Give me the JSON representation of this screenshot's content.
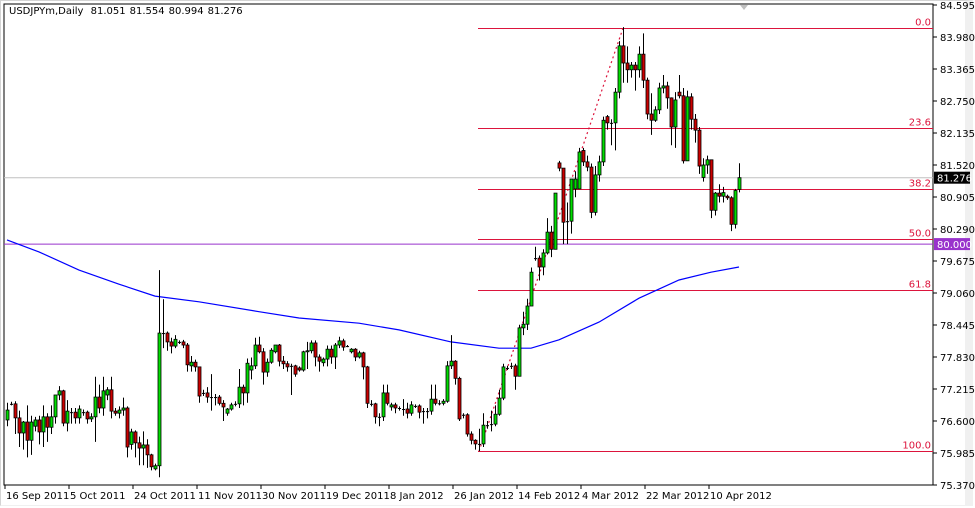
{
  "header": {
    "symbol": "USDJPYm,Daily",
    "open": "81.051",
    "high": "81.554",
    "low": "80.994",
    "close": "81.276"
  },
  "chart_data": {
    "type": "candlestick",
    "symbol": "USDJPYm",
    "timeframe": "Daily",
    "ylim": [
      75.37,
      84.595
    ],
    "y_ticks": [
      "84.595",
      "83.980",
      "83.365",
      "82.750",
      "82.135",
      "81.520",
      "80.905",
      "80.290",
      "79.675",
      "79.060",
      "78.445",
      "77.830",
      "77.215",
      "76.600",
      "75.985",
      "75.370"
    ],
    "x_ticks": [
      {
        "bar": 0,
        "label": "16 Sep 2011"
      },
      {
        "bar": 16,
        "label": "5 Oct 2011"
      },
      {
        "bar": 32,
        "label": "24 Oct 2011"
      },
      {
        "bar": 48,
        "label": "11 Nov 2011"
      },
      {
        "bar": 64,
        "label": "30 Nov 2011"
      },
      {
        "bar": 80,
        "label": "19 Dec 2011"
      },
      {
        "bar": 96,
        "label": "8 Jan 2012"
      },
      {
        "bar": 112,
        "label": "26 Jan 2012"
      },
      {
        "bar": 128,
        "label": "14 Feb 2012"
      },
      {
        "bar": 144,
        "label": "4 Mar 2012"
      },
      {
        "bar": 160,
        "label": "22 Mar 2012"
      },
      {
        "bar": 176,
        "label": "10 Apr 2012"
      }
    ],
    "ohlc": [
      [
        76.62,
        76.95,
        76.5,
        76.81
      ],
      [
        76.93,
        76.97,
        76.9,
        76.93
      ],
      [
        76.93,
        76.98,
        76.35,
        76.66
      ],
      [
        76.66,
        76.8,
        76.1,
        76.37
      ],
      [
        76.37,
        76.6,
        76.05,
        76.58
      ],
      [
        76.58,
        76.9,
        75.9,
        76.23
      ],
      [
        76.23,
        76.7,
        75.95,
        76.58
      ],
      [
        76.5,
        76.68,
        76.4,
        76.62
      ],
      [
        76.62,
        76.7,
        76.15,
        76.39
      ],
      [
        76.39,
        76.9,
        76.1,
        76.68
      ],
      [
        76.68,
        76.75,
        76.2,
        76.48
      ],
      [
        76.48,
        76.9,
        76.35,
        76.68
      ],
      [
        76.68,
        77.1,
        76.55,
        77.1
      ],
      [
        77.1,
        77.27,
        77.0,
        77.18
      ],
      [
        77.18,
        77.2,
        76.5,
        76.56
      ],
      [
        76.56,
        77.0,
        76.4,
        76.79
      ],
      [
        76.77,
        76.85,
        76.55,
        76.77
      ],
      [
        76.77,
        76.85,
        76.55,
        76.66
      ],
      [
        76.66,
        76.9,
        76.55,
        76.83
      ],
      [
        76.77,
        76.82,
        76.7,
        76.77
      ],
      [
        76.77,
        76.8,
        76.55,
        76.64
      ],
      [
        76.64,
        76.75,
        76.58,
        76.68
      ],
      [
        76.68,
        77.45,
        76.2,
        77.06
      ],
      [
        77.06,
        77.3,
        76.75,
        76.85
      ],
      [
        76.85,
        77.45,
        76.7,
        77.18
      ],
      [
        77.1,
        77.25,
        77.0,
        77.2
      ],
      [
        77.2,
        77.45,
        76.65,
        76.79
      ],
      [
        76.79,
        76.85,
        76.7,
        76.75
      ],
      [
        76.75,
        76.88,
        76.65,
        76.81
      ],
      [
        76.81,
        77.05,
        76.7,
        76.85
      ],
      [
        76.85,
        76.88,
        75.9,
        76.1
      ],
      [
        76.15,
        76.45,
        76.05,
        76.39
      ],
      [
        76.39,
        76.42,
        75.9,
        76.18
      ],
      [
        76.18,
        76.3,
        75.75,
        76.08
      ],
      [
        76.08,
        76.4,
        75.75,
        76.14
      ],
      [
        76.14,
        76.25,
        75.7,
        75.95
      ],
      [
        75.95,
        75.97,
        75.65,
        75.72
      ],
      [
        75.68,
        75.78,
        75.65,
        75.74
      ],
      [
        75.74,
        79.5,
        75.52,
        78.29
      ],
      [
        78.29,
        78.94,
        78.0,
        78.29
      ],
      [
        78.29,
        78.32,
        77.95,
        78.12
      ],
      [
        78.12,
        78.2,
        77.9,
        78.04
      ],
      [
        78.04,
        78.25,
        78.0,
        78.17
      ],
      [
        78.12,
        78.15,
        78.08,
        78.12
      ],
      [
        78.12,
        78.16,
        78.0,
        78.06
      ],
      [
        78.06,
        78.1,
        77.55,
        77.68
      ],
      [
        77.66,
        77.85,
        77.55,
        77.73
      ],
      [
        77.73,
        77.78,
        77.55,
        77.64
      ],
      [
        77.64,
        77.64,
        76.95,
        77.08
      ],
      [
        77.14,
        77.2,
        77.08,
        77.14
      ],
      [
        77.14,
        77.25,
        76.95,
        77.06
      ],
      [
        77.06,
        77.5,
        76.8,
        77.06
      ],
      [
        77.06,
        77.12,
        76.9,
        77.06
      ],
      [
        77.06,
        77.1,
        76.9,
        76.94
      ],
      [
        76.94,
        77.0,
        76.6,
        76.87
      ],
      [
        76.75,
        76.85,
        76.7,
        76.83
      ],
      [
        76.83,
        76.95,
        76.8,
        76.91
      ],
      [
        76.93,
        76.98,
        76.88,
        76.93
      ],
      [
        76.93,
        77.6,
        76.85,
        77.25
      ],
      [
        77.25,
        77.3,
        76.9,
        77.14
      ],
      [
        77.14,
        77.8,
        76.95,
        77.71
      ],
      [
        77.58,
        77.82,
        77.4,
        77.66
      ],
      [
        77.66,
        78.2,
        77.6,
        78.06
      ],
      [
        78.06,
        78.22,
        77.9,
        77.93
      ],
      [
        77.93,
        78.0,
        77.3,
        77.54
      ],
      [
        77.54,
        77.8,
        77.45,
        77.73
      ],
      [
        77.73,
        78.0,
        77.7,
        77.96
      ],
      [
        77.93,
        78.06,
        77.9,
        78.06
      ],
      [
        78.06,
        78.08,
        77.65,
        77.75
      ],
      [
        77.75,
        77.85,
        77.6,
        77.7
      ],
      [
        77.7,
        77.75,
        77.55,
        77.64
      ],
      [
        77.66,
        77.7,
        77.1,
        77.66
      ],
      [
        77.66,
        77.68,
        77.45,
        77.5
      ],
      [
        77.62,
        77.65,
        77.55,
        77.58
      ],
      [
        77.58,
        77.95,
        77.55,
        77.93
      ],
      [
        77.93,
        78.12,
        77.6,
        77.95
      ],
      [
        77.95,
        78.15,
        77.9,
        78.1
      ],
      [
        78.1,
        78.15,
        77.65,
        77.83
      ],
      [
        77.83,
        77.88,
        77.55,
        77.75
      ],
      [
        77.72,
        77.82,
        77.65,
        77.79
      ],
      [
        77.79,
        78.05,
        77.65,
        77.98
      ],
      [
        77.98,
        78.05,
        77.7,
        77.83
      ],
      [
        77.83,
        78.1,
        77.6,
        78.06
      ],
      [
        78.06,
        78.22,
        78.0,
        78.14
      ],
      [
        78.14,
        78.18,
        77.95,
        78.02
      ],
      [
        78.04,
        78.06,
        78.02,
        78.04
      ],
      [
        77.93,
        78.0,
        77.9,
        77.98
      ],
      [
        77.98,
        78.0,
        77.75,
        77.83
      ],
      [
        77.83,
        77.95,
        77.8,
        77.91
      ],
      [
        77.91,
        77.93,
        77.4,
        77.64
      ],
      [
        77.64,
        77.66,
        76.85,
        76.94
      ],
      [
        76.93,
        77.0,
        76.88,
        76.93
      ],
      [
        76.93,
        76.95,
        76.55,
        76.68
      ],
      [
        76.68,
        76.75,
        76.5,
        76.68
      ],
      [
        76.68,
        77.3,
        76.6,
        77.14
      ],
      [
        77.14,
        77.3,
        76.9,
        76.94
      ],
      [
        76.87,
        76.95,
        76.8,
        76.91
      ],
      [
        76.91,
        76.95,
        76.75,
        76.85
      ],
      [
        76.85,
        76.88,
        76.8,
        76.85
      ],
      [
        76.83,
        77.02,
        76.7,
        76.83
      ],
      [
        76.83,
        76.95,
        76.65,
        76.75
      ],
      [
        76.75,
        76.98,
        76.7,
        76.91
      ],
      [
        76.89,
        76.92,
        76.85,
        76.89
      ],
      [
        76.89,
        76.92,
        76.65,
        76.77
      ],
      [
        76.79,
        76.85,
        76.55,
        76.79
      ],
      [
        76.79,
        76.85,
        76.65,
        76.79
      ],
      [
        76.79,
        77.3,
        76.72,
        77.02
      ],
      [
        77.02,
        77.3,
        76.9,
        76.94
      ],
      [
        76.94,
        77.0,
        76.9,
        76.94
      ],
      [
        76.94,
        77.02,
        76.9,
        76.98
      ],
      [
        76.98,
        77.75,
        76.95,
        77.66
      ],
      [
        77.66,
        78.25,
        77.6,
        77.75
      ],
      [
        77.75,
        77.77,
        77.3,
        77.42
      ],
      [
        77.42,
        77.45,
        76.6,
        76.64
      ],
      [
        76.72,
        76.75,
        76.65,
        76.72
      ],
      [
        76.72,
        76.75,
        76.3,
        76.35
      ],
      [
        76.35,
        76.4,
        76.15,
        76.23
      ],
      [
        76.23,
        76.25,
        76.05,
        76.16
      ],
      [
        76.16,
        76.45,
        76.02,
        76.16
      ],
      [
        76.16,
        76.75,
        76.1,
        76.52
      ],
      [
        76.52,
        76.6,
        76.45,
        76.52
      ],
      [
        76.54,
        76.8,
        76.4,
        76.54
      ],
      [
        76.54,
        76.9,
        76.5,
        76.73
      ],
      [
        76.73,
        77.2,
        76.7,
        77.04
      ],
      [
        77.04,
        77.7,
        77.0,
        77.64
      ],
      [
        77.62,
        77.66,
        77.58,
        77.62
      ],
      [
        77.66,
        77.72,
        77.6,
        77.66
      ],
      [
        77.66,
        77.7,
        77.2,
        77.46
      ],
      [
        77.46,
        78.45,
        77.46,
        78.39
      ],
      [
        78.39,
        78.7,
        78.25,
        78.46
      ],
      [
        78.46,
        78.95,
        78.35,
        78.81
      ],
      [
        78.81,
        79.55,
        78.81,
        79.46
      ],
      [
        79.73,
        79.95,
        79.68,
        79.73
      ],
      [
        79.73,
        79.78,
        79.3,
        79.56
      ],
      [
        79.56,
        79.9,
        79.4,
        79.83
      ],
      [
        79.83,
        80.5,
        79.8,
        80.23
      ],
      [
        80.23,
        80.35,
        79.75,
        79.9
      ],
      [
        79.9,
        80.98,
        79.9,
        80.98
      ],
      [
        81.56,
        81.6,
        81.4,
        81.46
      ],
      [
        81.46,
        81.46,
        80.0,
        80.42
      ],
      [
        80.44,
        80.8,
        80.0,
        80.44
      ],
      [
        80.44,
        81.25,
        80.2,
        81.25
      ],
      [
        81.06,
        81.4,
        80.9,
        81.25
      ],
      [
        81.06,
        81.85,
        81.06,
        81.77
      ],
      [
        81.8,
        81.85,
        81.5,
        81.58
      ],
      [
        81.58,
        81.7,
        81.4,
        81.48
      ],
      [
        81.48,
        81.55,
        80.5,
        80.61
      ],
      [
        80.61,
        81.5,
        80.55,
        81.33
      ],
      [
        81.33,
        81.7,
        81.2,
        81.58
      ],
      [
        81.58,
        82.45,
        81.5,
        82.38
      ],
      [
        82.45,
        82.48,
        82.2,
        82.33
      ],
      [
        82.33,
        82.4,
        81.9,
        82.33
      ],
      [
        82.33,
        83.0,
        81.8,
        82.92
      ],
      [
        82.92,
        83.9,
        82.8,
        83.81
      ],
      [
        83.81,
        84.17,
        83.1,
        83.48
      ],
      [
        83.48,
        83.8,
        83.1,
        83.35
      ],
      [
        83.35,
        83.5,
        83.2,
        83.44
      ],
      [
        83.44,
        83.5,
        82.95,
        83.35
      ],
      [
        83.35,
        83.8,
        83.2,
        83.65
      ],
      [
        83.65,
        84.05,
        83.0,
        83.15
      ],
      [
        83.15,
        83.2,
        82.4,
        82.5
      ],
      [
        82.5,
        82.9,
        82.1,
        82.38
      ],
      [
        82.38,
        82.65,
        82.35,
        82.58
      ],
      [
        82.58,
        83.1,
        82.5,
        83.0
      ],
      [
        83.0,
        83.25,
        82.9,
        83.04
      ],
      [
        83.04,
        83.12,
        82.6,
        82.81
      ],
      [
        82.81,
        82.82,
        81.9,
        82.25
      ],
      [
        82.25,
        82.92,
        81.85,
        82.77
      ],
      [
        82.92,
        83.25,
        82.8,
        82.85
      ],
      [
        82.85,
        83.0,
        81.55,
        81.6
      ],
      [
        81.6,
        82.95,
        81.6,
        82.83
      ],
      [
        82.83,
        82.9,
        82.2,
        82.4
      ],
      [
        82.4,
        82.5,
        81.95,
        82.19
      ],
      [
        82.19,
        82.25,
        81.35,
        81.5
      ],
      [
        81.28,
        81.65,
        81.2,
        81.52
      ],
      [
        81.52,
        81.7,
        81.35,
        81.62
      ],
      [
        81.62,
        81.62,
        80.5,
        80.65
      ],
      [
        80.65,
        81.0,
        80.55,
        80.98
      ],
      [
        80.98,
        81.15,
        80.8,
        80.92
      ],
      [
        80.92,
        81.1,
        80.8,
        80.99
      ],
      [
        80.92,
        80.95,
        80.85,
        80.89
      ],
      [
        80.89,
        80.92,
        80.25,
        80.38
      ],
      [
        80.38,
        81.06,
        80.3,
        81.03
      ],
      [
        81.051,
        81.554,
        80.994,
        81.276
      ]
    ],
    "moving_average": [
      [
        0,
        80.08
      ],
      [
        8,
        79.85
      ],
      [
        18,
        79.5
      ],
      [
        28,
        79.23
      ],
      [
        37,
        79.0
      ],
      [
        48,
        78.89
      ],
      [
        63,
        78.7
      ],
      [
        73,
        78.58
      ],
      [
        88,
        78.48
      ],
      [
        98,
        78.35
      ],
      [
        111,
        78.12
      ],
      [
        123,
        78.0
      ],
      [
        131,
        78.0
      ],
      [
        138,
        78.16
      ],
      [
        148,
        78.5
      ],
      [
        158,
        78.96
      ],
      [
        168,
        79.31
      ],
      [
        176,
        79.46
      ],
      [
        183,
        79.56
      ]
    ],
    "fibonacci": {
      "from": {
        "bar": 118,
        "price": 76.02
      },
      "to": {
        "bar": 154,
        "price": 84.15
      },
      "levels": [
        {
          "label": "0.0",
          "price": 84.15
        },
        {
          "label": "23.6",
          "price": 82.23
        },
        {
          "label": "38.2",
          "price": 81.05
        },
        {
          "label": "50.0",
          "price": 80.09
        },
        {
          "label": "61.8",
          "price": 79.12
        },
        {
          "label": "100.0",
          "price": 76.02
        }
      ]
    },
    "bid_line": {
      "price": 81.276,
      "label": "81.276"
    },
    "horizontal_line": {
      "price": 80.0,
      "label": "80.000"
    },
    "colors": {
      "up": "#00dd00",
      "down": "#cc0000",
      "outline": "#000000",
      "ma": "#0000ff",
      "fib": "#dc143c",
      "hline": "#9933cc",
      "bid": "#c0c0c0",
      "bid_label": "#000000"
    }
  }
}
